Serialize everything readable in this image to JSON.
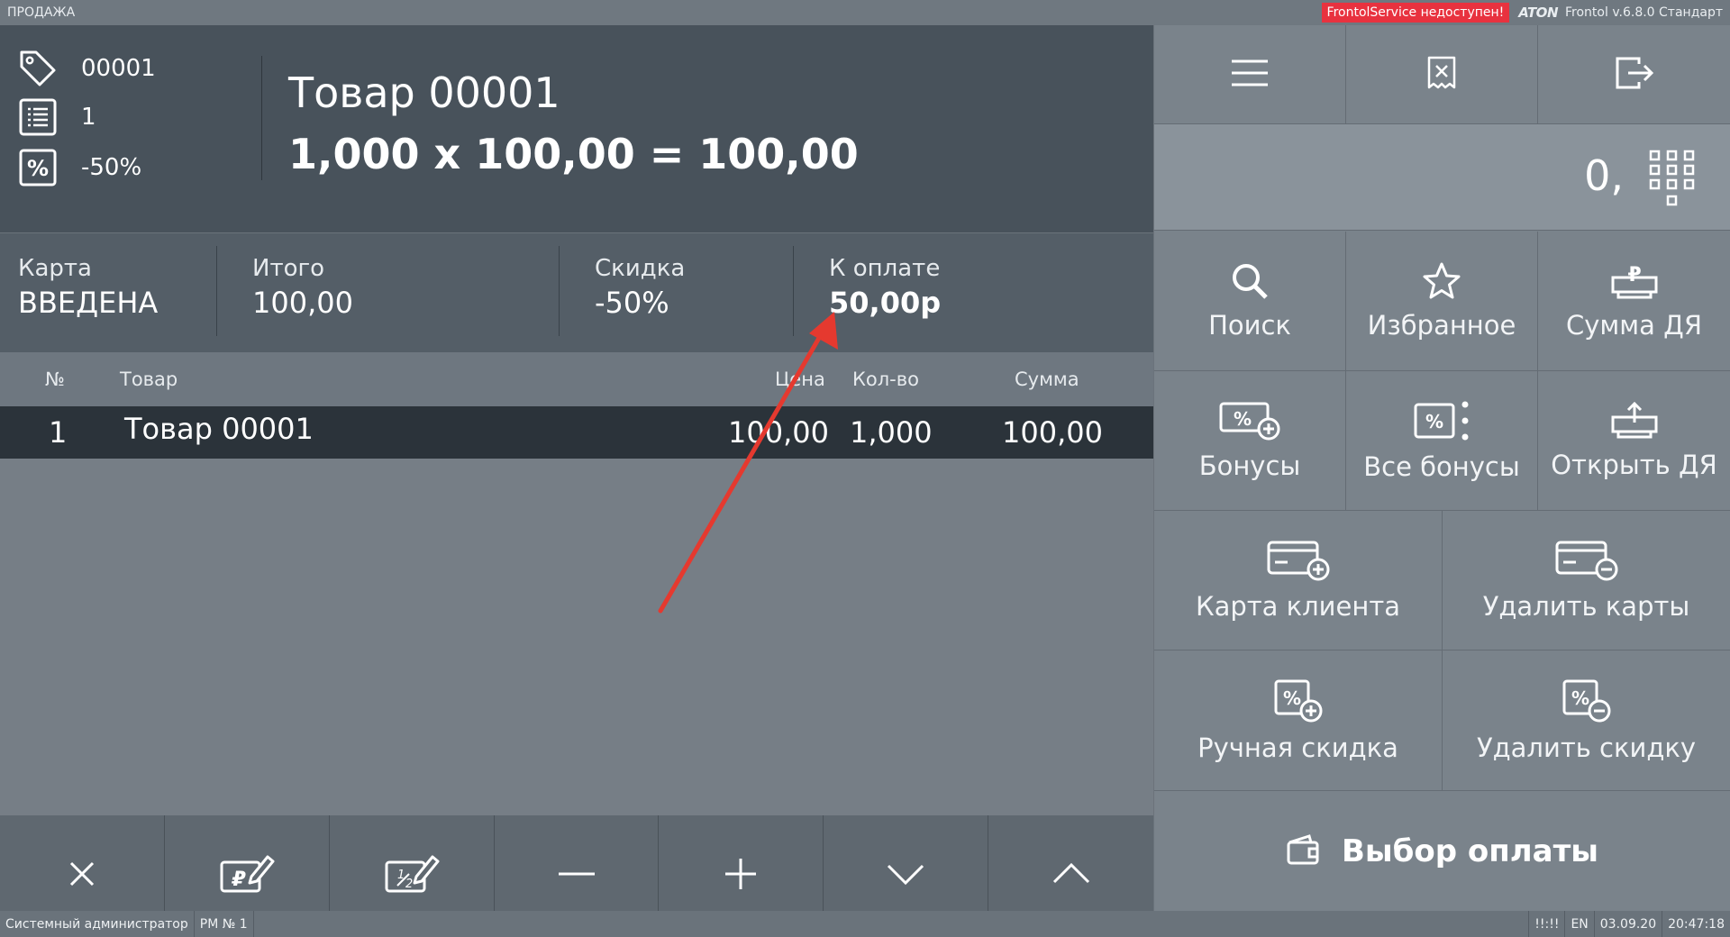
{
  "titlebar": {
    "mode": "ПРОДАЖА",
    "warning": "FrontolService недоступен!",
    "logo": "ATON",
    "version": "Frontol v.6.8.0 Стандарт"
  },
  "current_item": {
    "code": "00001",
    "list_no": "1",
    "discount": "-50%",
    "name": "Товар 00001",
    "calc": "1,000 x 100,00 = 100,00"
  },
  "summary": {
    "card_label": "Карта",
    "card_value": "ВВЕДЕНА",
    "total_label": "Итого",
    "total_value": "100,00",
    "discount_label": "Скидка",
    "discount_value": "-50%",
    "topay_label": "К оплате",
    "topay_value": "50,00р"
  },
  "table": {
    "headers": {
      "no": "№",
      "item": "Товар",
      "price": "Цена",
      "qty": "Кол-во",
      "sum": "Сумма"
    },
    "rows": [
      {
        "no": "1",
        "item": "Товар 00001",
        "price": "100,00",
        "qty": "1,000",
        "sum": "100,00"
      }
    ]
  },
  "bottom_buttons": [
    "close-icon",
    "price-edit-icon",
    "quantity-edit-icon",
    "minus-icon",
    "plus-icon",
    "chevron-down-icon",
    "chevron-up-icon"
  ],
  "right_panel": {
    "number_input": "0,",
    "buttons": {
      "search": "Поиск",
      "favorites": "Избранное",
      "cash_sum": "Сумма ДЯ",
      "bonuses": "Бонусы",
      "all_bonuses": "Все бонусы",
      "open_drawer": "Открыть ДЯ",
      "client_card": "Карта клиента",
      "delete_cards": "Удалить карты",
      "manual_discount": "Ручная скидка",
      "delete_discount": "Удалить скидку",
      "payment": "Выбор оплаты"
    }
  },
  "statusbar": {
    "user": "Системный администратор",
    "workplace": "РМ № 1",
    "indicator": "!!:!!",
    "lang": "EN",
    "date": "03.09.20",
    "time": "20:47:18"
  },
  "colors": {
    "warning": "#e8323f",
    "annotation_arrow": "#e5392f",
    "selected_row": "#2b333a",
    "header_panel": "#48525b"
  }
}
